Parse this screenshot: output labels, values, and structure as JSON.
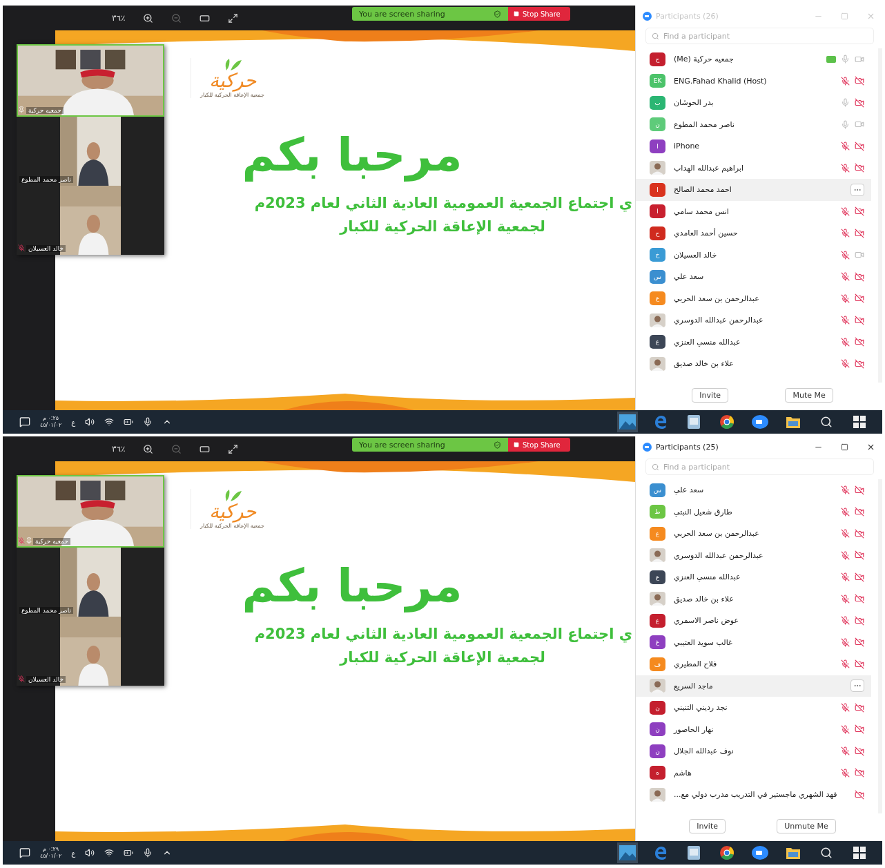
{
  "screens": [
    {
      "toolbar": {
        "zoom": "٣٦٪"
      },
      "share_bar": {
        "status": "You are screen sharing",
        "stop": "Stop Share"
      },
      "videos": [
        {
          "name": "جمعيه حركية",
          "pinned": true,
          "muted": false
        },
        {
          "name": "ناصر محمد المطوع",
          "pinned": false,
          "muted": false
        },
        {
          "name": "خالد العسيلان",
          "pinned": false,
          "muted": true
        }
      ],
      "slide": {
        "logo_mark": "حركية",
        "logo_caption": "جمعية الإعاقة الحركية للكبار",
        "title": "مرحبا بكم",
        "subtitle": [
          "ي اجتماع الجمعية العمومية العادية الثاني لعام 2023م",
          "لجمعية الإعاقة الحركية للكبار"
        ]
      },
      "participants": {
        "title": "Participants (26)",
        "active": false,
        "search": {
          "placeholder": "Find a participant"
        },
        "rows": [
          {
            "kind": "initials",
            "initials": "ج",
            "color": "#c41f2e",
            "name": "جمعيه حركية (Me)",
            "muted": false,
            "video_on": true,
            "sharing": true,
            "hovered": false
          },
          {
            "kind": "initials",
            "initials": "EK",
            "color": "#4cc36a",
            "name": "ENG.Fahad Khalid (Host)",
            "muted": true,
            "video_on": false,
            "sharing": false,
            "hovered": false
          },
          {
            "kind": "initials",
            "initials": "ب",
            "color": "#2bb673",
            "name": "بدر الحوشان",
            "muted": false,
            "video_on": false,
            "sharing": false,
            "hovered": false
          },
          {
            "kind": "initials",
            "initials": "ن",
            "color": "#5ecb7a",
            "name": "ناصر محمد المطوع",
            "muted": false,
            "video_on": true,
            "sharing": false,
            "hovered": false
          },
          {
            "kind": "initials",
            "initials": "I",
            "color": "#8e3fc0",
            "name": "iPhone",
            "muted": true,
            "video_on": false,
            "sharing": false,
            "hovered": false
          },
          {
            "name": "ابراهيم عبدالله الهداب",
            "muted": true,
            "video_on": false,
            "sharing": false,
            "hovered": false
          },
          {
            "kind": "initials",
            "initials": "I",
            "color": "#d9331e",
            "name": "احمد محمد الصالح",
            "sharing": false,
            "hovered": true
          },
          {
            "kind": "initials",
            "initials": "ا",
            "color": "#c8202f",
            "name": "انس محمد سامي",
            "muted": true,
            "video_on": false,
            "sharing": false,
            "hovered": false
          },
          {
            "kind": "initials",
            "initials": "ح",
            "color": "#d02a1e",
            "name": "حسين أحمد العامدي",
            "muted": true,
            "video_on": false,
            "sharing": false,
            "hovered": false
          },
          {
            "kind": "initials",
            "initials": "خ",
            "color": "#3a9bd5",
            "name": "خالد العسيلان",
            "muted": true,
            "video_on": true,
            "sharing": false,
            "hovered": false
          },
          {
            "kind": "initials",
            "initials": "س",
            "color": "#3b8fd0",
            "name": "سعد علي",
            "muted": true,
            "video_on": false,
            "sharing": false,
            "hovered": false
          },
          {
            "kind": "initials",
            "initials": "ع",
            "color": "#f58a1f",
            "name": "عبدالرحمن بن سعد الحربي",
            "muted": true,
            "video_on": false,
            "sharing": false,
            "hovered": false
          },
          {
            "name": "عبدالرحمن عبدالله الدوسري",
            "muted": true,
            "video_on": false,
            "sharing": false,
            "hovered": false
          },
          {
            "kind": "initials",
            "initials": "ع",
            "color": "#3c4656",
            "name": "عبدالله منسي العنزي",
            "muted": true,
            "video_on": false,
            "sharing": false,
            "hovered": false
          },
          {
            "name": "علاء بن خالد صديق",
            "muted": true,
            "video_on": false,
            "sharing": false,
            "hovered": false
          }
        ],
        "buttons": {
          "invite": "Invite",
          "mute": "Mute Me"
        }
      },
      "taskbar": {
        "time": "٠:٢٥ م",
        "date": "٤٥/٠١/٠٢",
        "language": "ع"
      }
    },
    {
      "toolbar": {
        "zoom": "٣٦٪"
      },
      "share_bar": {
        "status": "You are screen sharing",
        "stop": "Stop Share"
      },
      "videos": [
        {
          "name": "جمعيه حركية",
          "pinned": true,
          "muted": true
        },
        {
          "name": "ناصر محمد المطوع",
          "pinned": false,
          "muted": false
        },
        {
          "name": "خالد العسيلان",
          "pinned": false,
          "muted": true
        }
      ],
      "slide": {
        "logo_mark": "حركية",
        "logo_caption": "جمعية الإعاقة الحركية للكبار",
        "title": "مرحبا بكم",
        "subtitle": [
          "ي اجتماع الجمعية العمومية العادية الثاني لعام 2023م",
          "لجمعية الإعاقة الحركية للكبار"
        ]
      },
      "participants": {
        "title": "Participants (25)",
        "active": true,
        "search": {
          "placeholder": "Find a participant"
        },
        "rows": [
          {
            "kind": "initials",
            "initials": "س",
            "color": "#3b8fd0",
            "name": "سعد علي",
            "muted": true,
            "video_on": false,
            "sharing": false,
            "hovered": false
          },
          {
            "kind": "initials",
            "initials": "ط",
            "color": "#6cc644",
            "name": "طارق شعيل النبتي",
            "muted": true,
            "video_on": false,
            "sharing": false,
            "hovered": false
          },
          {
            "kind": "initials",
            "initials": "ع",
            "color": "#f58a1f",
            "name": "عبدالرحمن بن سعد الحربي",
            "muted": true,
            "video_on": false,
            "sharing": false,
            "hovered": false
          },
          {
            "name": "عبدالرحمن عبدالله الدوسري",
            "muted": true,
            "video_on": false,
            "sharing": false,
            "hovered": false
          },
          {
            "kind": "initials",
            "initials": "ع",
            "color": "#3c4656",
            "name": "عبدالله منسي العنزي",
            "muted": true,
            "video_on": false,
            "sharing": false,
            "hovered": false
          },
          {
            "name": "علاء بن خالد صديق",
            "muted": true,
            "video_on": false,
            "sharing": false,
            "hovered": false
          },
          {
            "kind": "initials",
            "initials": "ع",
            "color": "#c41f2e",
            "name": "عوض ناصر الاسمري",
            "muted": true,
            "video_on": false,
            "sharing": false,
            "hovered": false
          },
          {
            "kind": "initials",
            "initials": "غ",
            "color": "#8e3fc0",
            "name": "غالب سويد العتيبي",
            "muted": true,
            "video_on": false,
            "sharing": false,
            "hovered": false
          },
          {
            "kind": "initials",
            "initials": "ف",
            "color": "#f58a1f",
            "name": "فلاح المطيري",
            "muted": true,
            "video_on": false,
            "sharing": false,
            "hovered": false
          },
          {
            "name": "ماجد السريع",
            "sharing": false,
            "hovered": true
          },
          {
            "kind": "initials",
            "initials": "ن",
            "color": "#c41f2e",
            "name": "نجد رديني التنيني",
            "muted": true,
            "video_on": false,
            "sharing": false,
            "hovered": false
          },
          {
            "kind": "initials",
            "initials": "ن",
            "color": "#8e3fc0",
            "name": "نهار الحاصور",
            "muted": true,
            "video_on": false,
            "sharing": false,
            "hovered": false
          },
          {
            "kind": "initials",
            "initials": "ن",
            "color": "#8e3fc0",
            "name": "نوف عبدالله الجلال",
            "muted": true,
            "video_on": false,
            "sharing": false,
            "hovered": false
          },
          {
            "kind": "initials",
            "initials": "ه",
            "color": "#c41f2e",
            "name": "هاشم",
            "muted": true,
            "video_on": false,
            "sharing": false,
            "hovered": false
          },
          {
            "name": "فهد الشهري ماجستير في التدريب مدرب دولي مع...",
            "video_on": false,
            "sharing": false,
            "hovered": false
          }
        ],
        "buttons": {
          "invite": "Invite",
          "mute": "Unmute Me"
        }
      },
      "taskbar": {
        "time": "٠:٢٩ م",
        "date": "٤٥/٠١/٠٢",
        "language": "ع"
      }
    }
  ]
}
